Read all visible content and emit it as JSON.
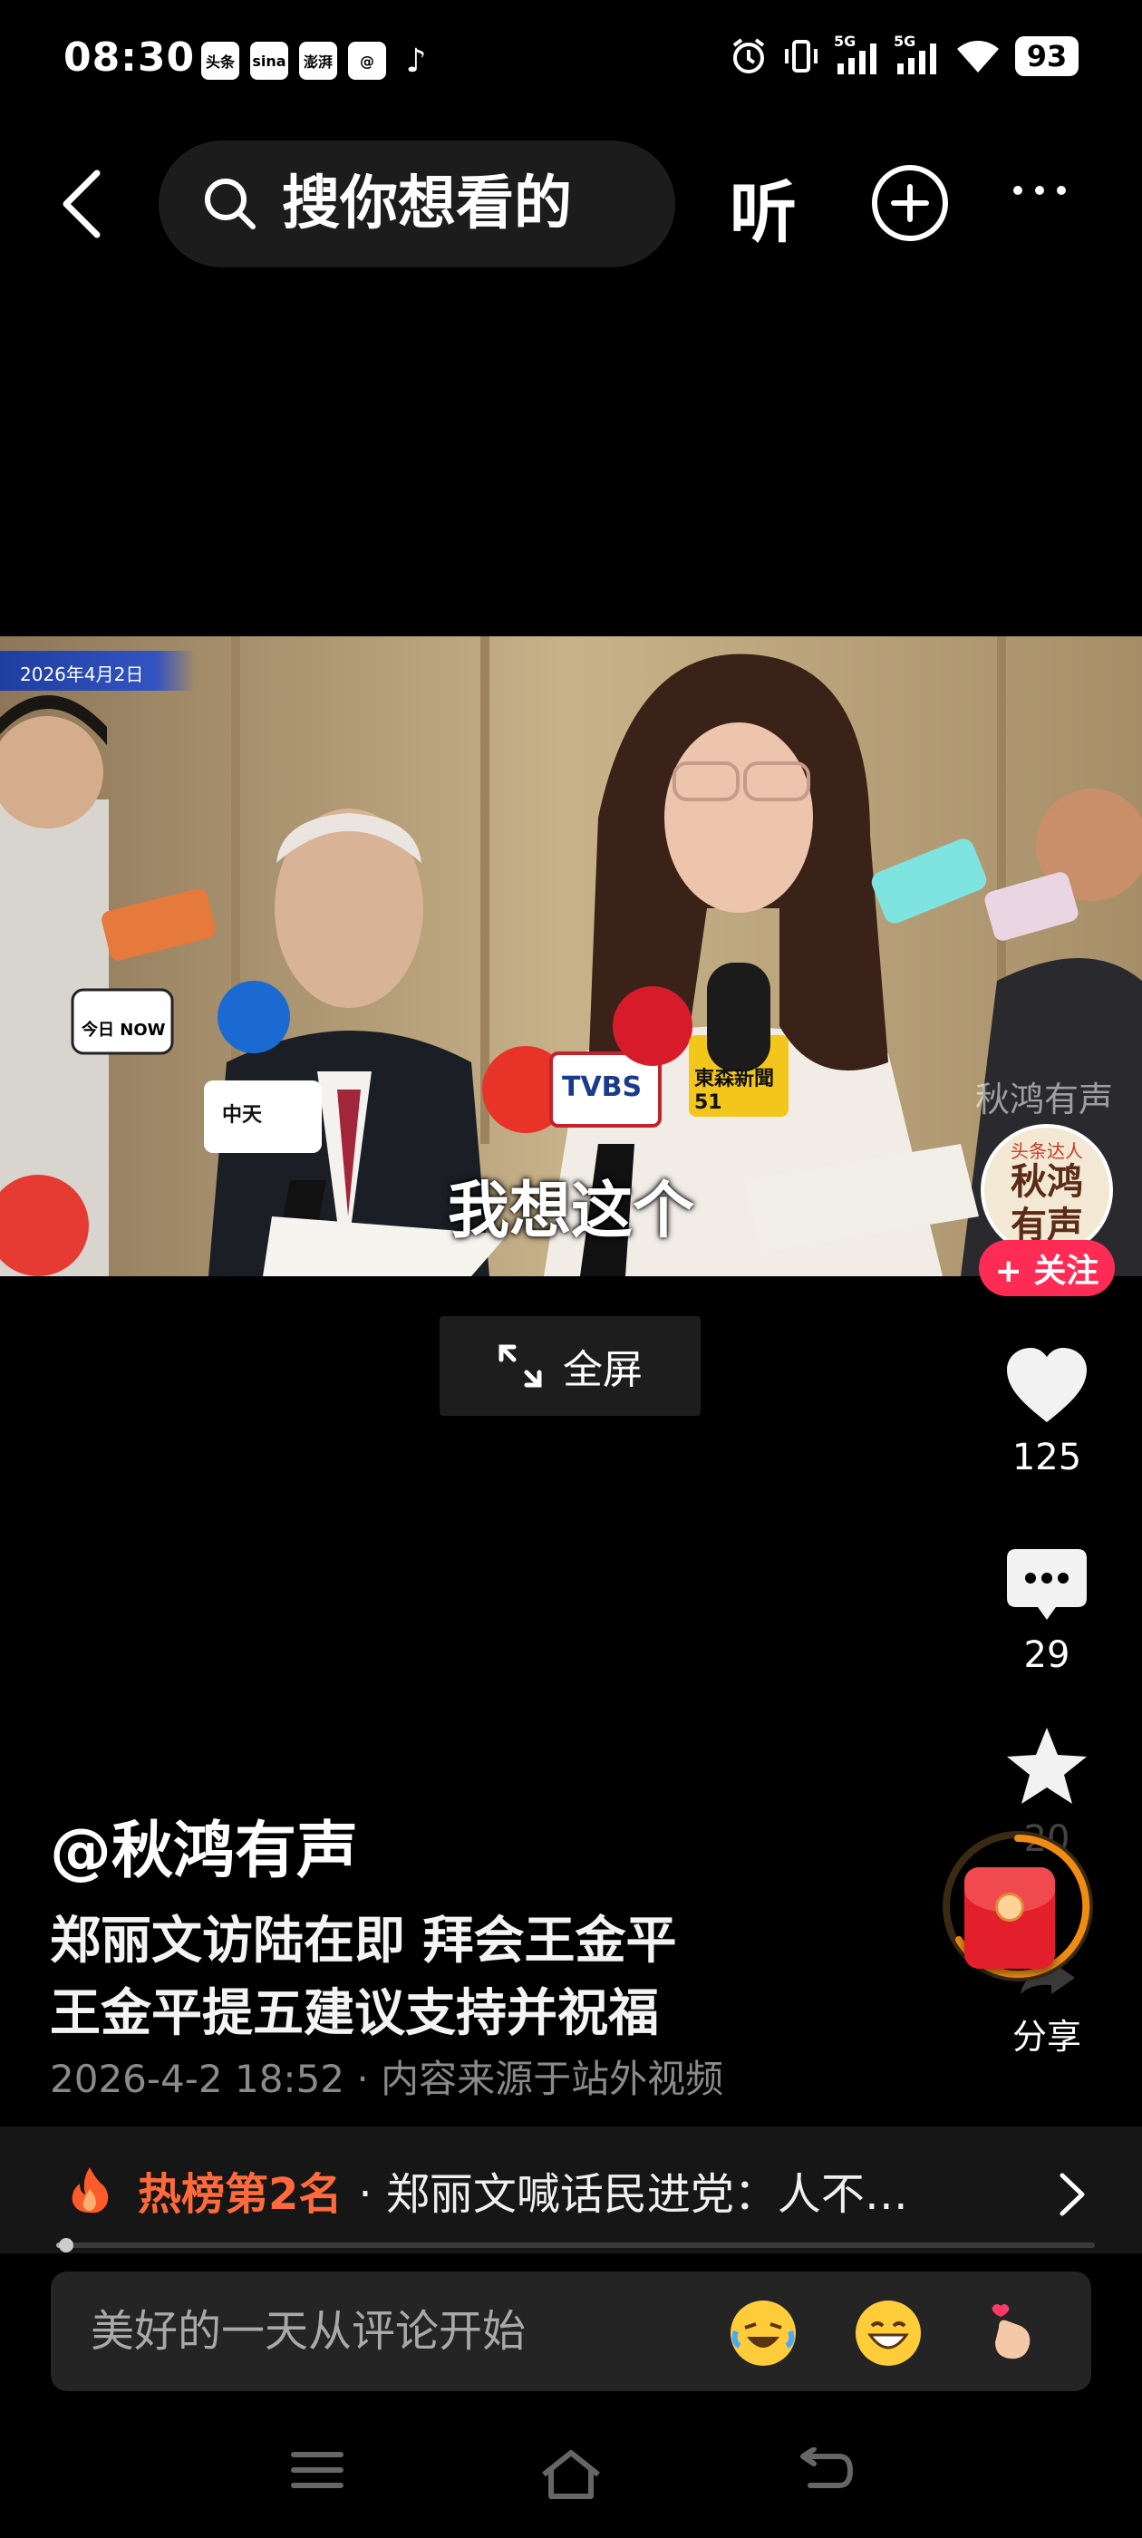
{
  "status_bar": {
    "time": "08:30",
    "app_badges": [
      "头条",
      "sina",
      "澎湃",
      "@",
      "♪"
    ],
    "network_1": "5G",
    "network_2": "5G",
    "battery": "93"
  },
  "top_nav": {
    "search_placeholder": "搜你想看的",
    "listen_label": "听"
  },
  "video": {
    "date_stamp": "2026年4月2日",
    "subtitle": "我想这个",
    "watermark": "秋鸿有声",
    "fullscreen_label": "全屏",
    "mic_labels": [
      "今日 NOW",
      "TVBS",
      "東森新聞51",
      "中天"
    ]
  },
  "rail": {
    "avatar_small": "头条达人",
    "avatar_name": "秋鸿有声",
    "follow_label": "+ 关注",
    "likes": "125",
    "comments": "29",
    "favorites": "20",
    "share_label": "分享"
  },
  "post": {
    "author": "@秋鸿有声",
    "line1": "郑丽文访陆在即  拜会王金平",
    "line2": "王金平提五建议支持并祝福",
    "meta": "2026-4-2 18:52 · 内容来源于站外视频"
  },
  "hot": {
    "rank": "热榜第2名",
    "text": "· 郑丽文喊话民进党：人不…"
  },
  "progress": {
    "value": 0.01
  },
  "comment": {
    "placeholder": "美好的一天从评论开始",
    "emojis": [
      "laughing-crying-emoji",
      "grinning-emoji",
      "finger-heart-emoji"
    ]
  }
}
